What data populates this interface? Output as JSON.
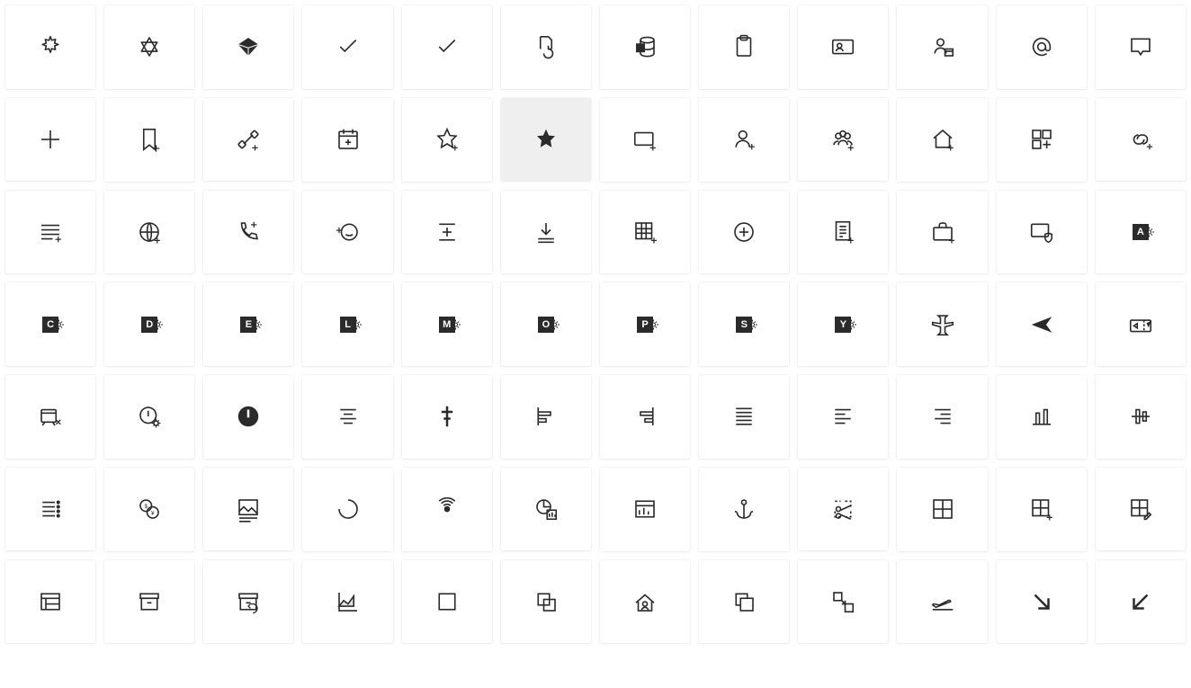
{
  "grid": {
    "columns": 12,
    "selected_index": 17,
    "icons": [
      {
        "name": "sun-outline-icon"
      },
      {
        "name": "star-of-david-icon"
      },
      {
        "name": "diamond-3d-icon"
      },
      {
        "name": "checkmark-icon"
      },
      {
        "name": "checkmark-icon"
      },
      {
        "name": "document-recurring-icon"
      },
      {
        "name": "access-database-icon"
      },
      {
        "name": "clipboard-icon"
      },
      {
        "name": "contact-card-icon"
      },
      {
        "name": "account-management-icon"
      },
      {
        "name": "at-sign-icon"
      },
      {
        "name": "annotation-icon"
      },
      {
        "name": "add-icon"
      },
      {
        "name": "add-bookmark-icon"
      },
      {
        "name": "add-connection-icon"
      },
      {
        "name": "add-event-icon"
      },
      {
        "name": "add-favorite-star-icon"
      },
      {
        "name": "favorite-star-fill-icon"
      },
      {
        "name": "add-screen-icon"
      },
      {
        "name": "add-friend-icon"
      },
      {
        "name": "add-group-icon"
      },
      {
        "name": "add-home-icon"
      },
      {
        "name": "add-in-tiles-icon"
      },
      {
        "name": "add-link-icon"
      },
      {
        "name": "add-notes-icon"
      },
      {
        "name": "add-online-meeting-icon"
      },
      {
        "name": "add-phone-icon"
      },
      {
        "name": "add-reaction-icon"
      },
      {
        "name": "align-distribute-vertical-icon"
      },
      {
        "name": "download-to-line-icon"
      },
      {
        "name": "add-table-icon"
      },
      {
        "name": "add-circle-icon"
      },
      {
        "name": "add-document-plus-icon"
      },
      {
        "name": "add-work-icon"
      },
      {
        "name": "add-screen-shield-icon"
      },
      {
        "name": "admin-a-logo-icon"
      },
      {
        "name": "admin-c-logo-icon"
      },
      {
        "name": "admin-d-logo-icon"
      },
      {
        "name": "admin-e-logo-icon"
      },
      {
        "name": "admin-l-logo-icon"
      },
      {
        "name": "admin-m-logo-icon"
      },
      {
        "name": "admin-o-logo-icon"
      },
      {
        "name": "admin-p-logo-icon"
      },
      {
        "name": "admin-s-logo-icon"
      },
      {
        "name": "admin-y-logo-icon"
      },
      {
        "name": "airplane-outline-icon"
      },
      {
        "name": "airplane-solid-icon"
      },
      {
        "name": "air-tickets-icon"
      },
      {
        "name": "alarm-clock-cancel-icon"
      },
      {
        "name": "alert-settings-icon"
      },
      {
        "name": "alert-solid-icon"
      },
      {
        "name": "align-center-icon"
      },
      {
        "name": "align-horizontal-center-icon"
      },
      {
        "name": "align-left-edge-icon"
      },
      {
        "name": "align-right-edge-icon"
      },
      {
        "name": "align-justify-icon"
      },
      {
        "name": "align-text-left-icon"
      },
      {
        "name": "align-text-right-icon"
      },
      {
        "name": "align-bottom-bars-icon"
      },
      {
        "name": "align-vertical-center-tall-icon"
      },
      {
        "name": "all-apps-list-icon"
      },
      {
        "name": "all-currency-icon"
      },
      {
        "name": "image-alt-text-icon"
      },
      {
        "name": "progress-ring-icon"
      },
      {
        "name": "signal-radar-icon"
      },
      {
        "name": "analytics-report-icon"
      },
      {
        "name": "analytics-view-icon"
      },
      {
        "name": "anchor-lock-icon"
      },
      {
        "name": "snip-tool-icon"
      },
      {
        "name": "tiles-four-icon"
      },
      {
        "name": "tiles-add-icon"
      },
      {
        "name": "tiles-edit-icon"
      },
      {
        "name": "news-layout-icon"
      },
      {
        "name": "archive-box-icon"
      },
      {
        "name": "archive-undo-icon"
      },
      {
        "name": "area-chart-icon"
      },
      {
        "name": "square-outline-icon"
      },
      {
        "name": "arrange-behind-icon"
      },
      {
        "name": "home-group-icon"
      },
      {
        "name": "arrange-front-icon"
      },
      {
        "name": "arrange-by-from-icon"
      },
      {
        "name": "departure-icon"
      },
      {
        "name": "arrow-down-right-icon"
      },
      {
        "name": "arrow-down-left-icon"
      }
    ],
    "letter_tiles": {
      "35": "A",
      "36": "C",
      "37": "D",
      "38": "E",
      "39": "L",
      "40": "M",
      "41": "O",
      "42": "P",
      "43": "S",
      "44": "Y"
    }
  }
}
